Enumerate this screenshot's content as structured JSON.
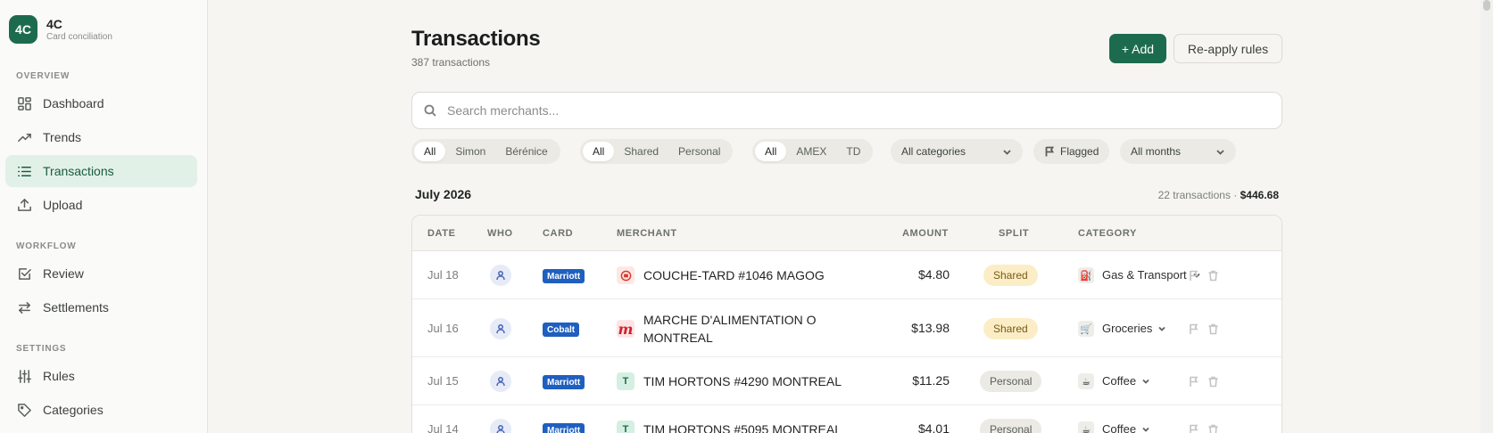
{
  "brand": {
    "logo": "4C",
    "name": "4C",
    "subtitle": "Card conciliation"
  },
  "sidebar": {
    "sections": [
      {
        "label": "OVERVIEW"
      },
      {
        "label": "WORKFLOW"
      },
      {
        "label": "SETTINGS"
      }
    ],
    "items": [
      {
        "label": "Dashboard",
        "icon": "dashboard-icon"
      },
      {
        "label": "Trends",
        "icon": "trend-icon"
      },
      {
        "label": "Transactions",
        "icon": "list-icon",
        "active": true
      },
      {
        "label": "Upload",
        "icon": "upload-icon"
      },
      {
        "label": "Review",
        "icon": "checkbox-icon"
      },
      {
        "label": "Settlements",
        "icon": "arrows-icon"
      },
      {
        "label": "Rules",
        "icon": "sliders-icon"
      },
      {
        "label": "Categories",
        "icon": "tag-icon"
      }
    ]
  },
  "header": {
    "title": "Transactions",
    "count": "387 transactions",
    "add_label": "+ Add",
    "reapply_label": "Re-apply rules"
  },
  "search": {
    "placeholder": "Search merchants..."
  },
  "filters": {
    "who": [
      "All",
      "Simon",
      "Bérénice"
    ],
    "split": [
      "All",
      "Shared",
      "Personal"
    ],
    "card": [
      "All",
      "AMEX",
      "TD"
    ],
    "category": "All categories",
    "flagged": "Flagged",
    "months": "All months"
  },
  "month": {
    "title": "July 2026",
    "summary_count": "22 transactions · ",
    "summary_total": "$446.68"
  },
  "table": {
    "columns": [
      "DATE",
      "WHO",
      "CARD",
      "MERCHANT",
      "AMOUNT",
      "SPLIT",
      "CATEGORY"
    ],
    "rows": [
      {
        "date": "Jul 18",
        "card": "Marriott",
        "merchant": "COUCHE-TARD #1046 MAGOG",
        "merchant_icon": "couche-tard-logo",
        "amount": "$4.80",
        "split": "Shared",
        "category": "Gas & Transport",
        "category_icon": "fuel-icon"
      },
      {
        "date": "Jul 16",
        "card": "Cobalt",
        "merchant": "MARCHE D'ALIMENTATION O MONTREAL",
        "merchant_icon": "metro-logo",
        "merchant_glyph": "m",
        "amount": "$13.98",
        "split": "Shared",
        "category": "Groceries",
        "category_icon": "cart-icon"
      },
      {
        "date": "Jul 15",
        "card": "Marriott",
        "merchant": "TIM HORTONS #4290 MONTREAL",
        "merchant_icon": "letter-t-icon",
        "merchant_glyph": "T",
        "amount": "$11.25",
        "split": "Personal",
        "category": "Coffee",
        "category_icon": "coffee-icon"
      },
      {
        "date": "Jul 14",
        "card": "Marriott",
        "merchant": "TIM HORTONS #5095 MONTREAL",
        "merchant_icon": "letter-t-icon",
        "merchant_glyph": "T",
        "amount": "$4.01",
        "split": "Personal",
        "category": "Coffee",
        "category_icon": "coffee-icon"
      }
    ]
  },
  "colors": {
    "accent": "#1d6b4f",
    "card_badge": "#1f5fbf",
    "shared_bg": "#fbedc6",
    "active_nav_bg": "#e2f1e8"
  }
}
